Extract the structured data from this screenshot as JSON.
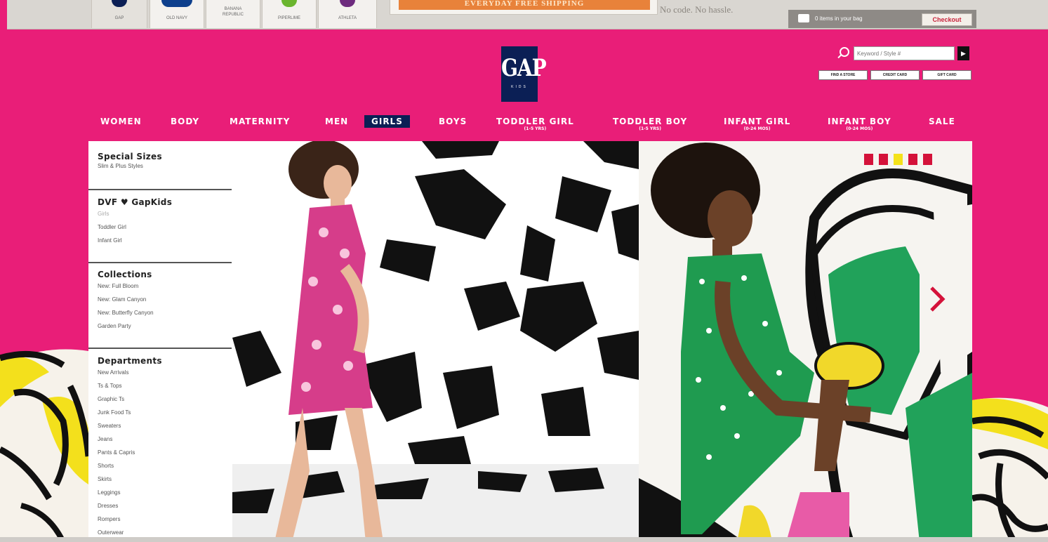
{
  "brand_tabs": [
    "GAP",
    "OLD NAVY",
    "BANANA REPUBLIC",
    "PIPERLIME",
    "ATHLETA"
  ],
  "promo": {
    "banner_text": "EVERYDAY FREE SHIPPING",
    "note": "No code. No hassle."
  },
  "bag": {
    "text": "0 items in your bag",
    "checkout_label": "Checkout"
  },
  "logo": {
    "main": "GAP",
    "sub": "KIDS"
  },
  "search": {
    "placeholder": "Keyword / Style #"
  },
  "utility_links": [
    "FIND A STORE",
    "CREDIT CARD",
    "GIFT CARD"
  ],
  "nav": [
    {
      "label": "WOMEN",
      "sub": ""
    },
    {
      "label": "BODY",
      "sub": ""
    },
    {
      "label": "MATERNITY",
      "sub": ""
    },
    {
      "label": "MEN",
      "sub": ""
    },
    {
      "label": "GIRLS",
      "sub": ""
    },
    {
      "label": "BOYS",
      "sub": ""
    },
    {
      "label": "TODDLER GIRL",
      "sub": "(1-5 YRS)"
    },
    {
      "label": "TODDLER BOY",
      "sub": "(1-5 YRS)"
    },
    {
      "label": "INFANT GIRL",
      "sub": "(0-24 MOS)"
    },
    {
      "label": "INFANT BOY",
      "sub": "(0-24 MOS)"
    },
    {
      "label": "SALE",
      "sub": ""
    }
  ],
  "active_nav": "GIRLS",
  "sidebar": {
    "groups": [
      {
        "heading": "Special Sizes",
        "items": [
          "Slim & Plus Styles"
        ]
      },
      {
        "heading": "DVF ♥ GapKids",
        "items": [
          "Girls",
          "Toddler Girl",
          "Infant Girl"
        ]
      },
      {
        "heading": "Collections",
        "items": [
          "New: Full Bloom",
          "New: Glam Canyon",
          "New: Butterfly Canyon",
          "Garden Party"
        ]
      },
      {
        "heading": "Departments",
        "items": [
          "New Arrivals",
          "Ts & Tops",
          "Graphic Ts",
          "Junk Food Ts",
          "Sweaters",
          "Jeans",
          "Pants & Capris",
          "Shorts",
          "Skirts",
          "Leggings",
          "Dresses",
          "Rompers",
          "Outerwear"
        ]
      }
    ]
  },
  "carousel": {
    "slide_count": 5,
    "active_slide": 3
  },
  "colors": {
    "page_bg": "#e91e78",
    "nav_active_bg": "#0b1f55",
    "logo_bg": "#0b1f55",
    "checkout_text": "#c8233b",
    "dot_inactive": "#d4123a",
    "dot_active": "#f4e21a"
  },
  "icons": {
    "search": "magnifier-icon",
    "go": "play-arrow-icon",
    "bag": "shopping-bag-icon",
    "next": "chevron-right-icon"
  }
}
